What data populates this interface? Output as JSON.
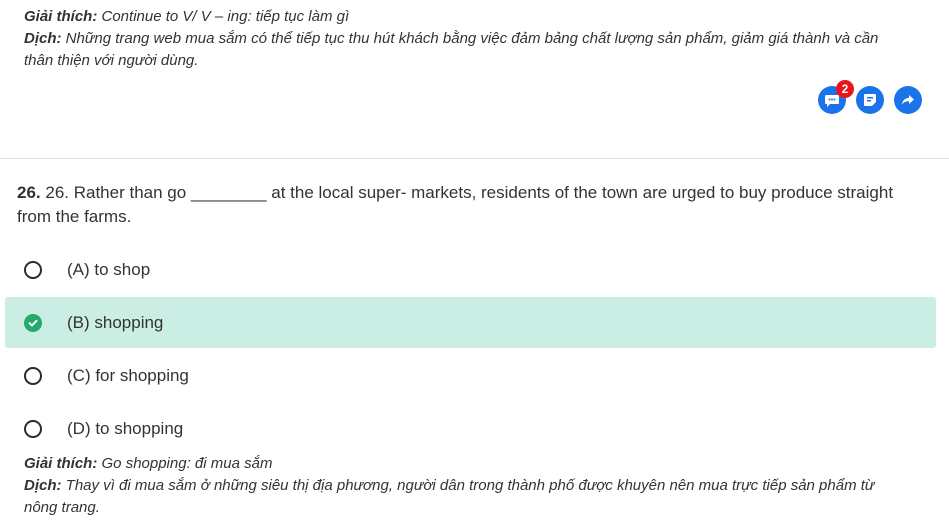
{
  "prev_explanation": {
    "label_explain": "Giải thích:",
    "text_explain": " Continue to V/ V – ing: tiếp tục làm gì",
    "label_translate": "Dịch:",
    "text_translate_1": " Những trang web mua sắm có thể tiếp tục thu hút khách bằng việc đảm bảng chất lượng sản phẩm, giảm giá thành và cần",
    "text_translate_2": "thân thiện với người dùng."
  },
  "actions": {
    "comment_badge": "2"
  },
  "question": {
    "number": "26.",
    "text_1": " 26. Rather than go ________ at the local super- markets, residents of the town are urged to buy produce straight",
    "text_2": "from the farms.",
    "options": [
      {
        "label": "(A) to shop",
        "selected": false
      },
      {
        "label": "(B) shopping",
        "selected": true
      },
      {
        "label": "(C) for shopping",
        "selected": false
      },
      {
        "label": "(D) to shopping",
        "selected": false
      }
    ]
  },
  "explanation": {
    "label_explain": "Giải thích:",
    "text_explain": " Go shopping: đi mua sắm",
    "label_translate": "Dịch:",
    "text_translate_1": " Thay vì đi mua sắm ở những siêu thị địa phương, người dân trong thành phố được khuyên nên mua trực tiếp sản phẩm từ",
    "text_translate_2": "nông trang."
  },
  "colors": {
    "accent": "#1a73e8",
    "badge": "#e8151b",
    "correct": "#26a96c",
    "selected_bg": "#cbeee4"
  }
}
